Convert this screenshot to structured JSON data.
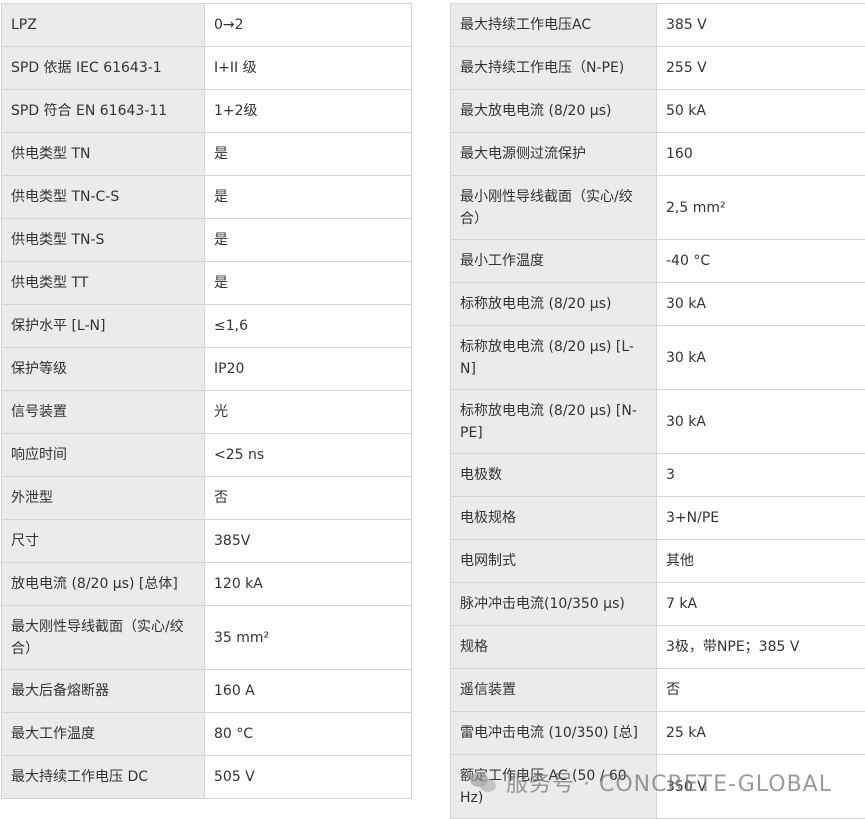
{
  "left_rows": [
    {
      "label": "LPZ",
      "value": "0→2"
    },
    {
      "label": "SPD 依据 IEC 61643-1",
      "value": "I+II 级"
    },
    {
      "label": "SPD 符合 EN 61643-11",
      "value": "1+2级"
    },
    {
      "label": "供电类型 TN",
      "value": "是"
    },
    {
      "label": "供电类型 TN-C-S",
      "value": "是"
    },
    {
      "label": "供电类型 TN-S",
      "value": "是"
    },
    {
      "label": "供电类型 TT",
      "value": "是"
    },
    {
      "label": "保护水平 [L-N]",
      "value": "≤1,6"
    },
    {
      "label": "保护等级",
      "value": "IP20"
    },
    {
      "label": "信号装置",
      "value": "光"
    },
    {
      "label": "响应时间",
      "value": "<25 ns"
    },
    {
      "label": "外泄型",
      "value": "否"
    },
    {
      "label": "尺寸",
      "value": "385V"
    },
    {
      "label": "放电电流 (8/20 μs) [总体]",
      "value": "120 kA"
    },
    {
      "label": "最大刚性导线截面（实心/绞合）",
      "value": "35 mm²"
    },
    {
      "label": "最大后备熔断器",
      "value": "160 A"
    },
    {
      "label": "最大工作温度",
      "value": "80 °C"
    },
    {
      "label": "最大持续工作电压 DC",
      "value": "505 V"
    }
  ],
  "right_rows": [
    {
      "label": "最大持续工作电压AC",
      "value": "385 V"
    },
    {
      "label": "最大持续工作电压（N-PE)",
      "value": "255 V"
    },
    {
      "label": "最大放电电流 (8/20 μs)",
      "value": "50 kA"
    },
    {
      "label": "最大电源侧过流保护",
      "value": "160"
    },
    {
      "label": "最小刚性导线截面（实心/绞合）",
      "value": "2,5 mm²"
    },
    {
      "label": "最小工作温度",
      "value": "-40 °C"
    },
    {
      "label": "标称放电电流 (8/20 μs)",
      "value": "30 kA"
    },
    {
      "label": "标称放电电流 (8/20 μs) [L-N]",
      "value": "30 kA"
    },
    {
      "label": "标称放电电流 (8/20 μs) [N-PE]",
      "value": "30 kA"
    },
    {
      "label": "电极数",
      "value": "3"
    },
    {
      "label": "电极规格",
      "value": "3+N/PE"
    },
    {
      "label": "电网制式",
      "value": "其他"
    },
    {
      "label": "脉冲冲击电流(10/350 μs)",
      "value": "7 kA"
    },
    {
      "label": "规格",
      "value": "3极，带NPE；385 V"
    },
    {
      "label": "遥信装置",
      "value": "否"
    },
    {
      "label": "雷电冲击电流 (10/350) [总]",
      "value": "25 kA"
    },
    {
      "label": "额定工作电压 AC (50 / 60 Hz)",
      "value": "350 V"
    }
  ],
  "watermark": {
    "icon": "wechat-icon",
    "text": "服务号 · CONCRETE-GLOBAL"
  }
}
